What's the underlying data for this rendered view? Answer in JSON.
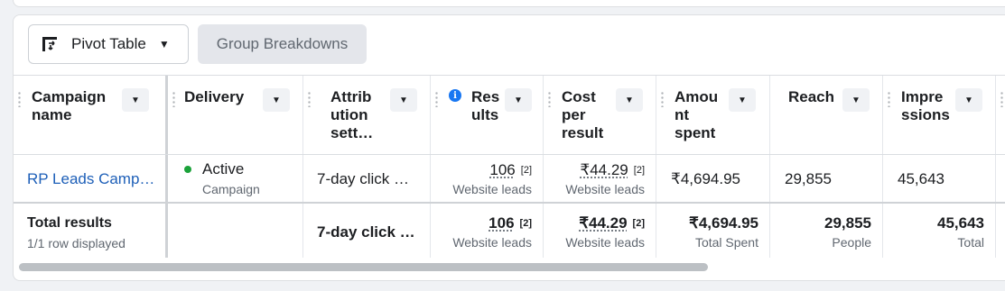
{
  "toolbar": {
    "pivot_label": "Pivot Table",
    "group_label": "Group Breakdowns"
  },
  "columns": [
    {
      "title_lines": [
        "Campaign",
        "name"
      ]
    },
    {
      "title_lines": [
        "Delivery"
      ]
    },
    {
      "title_lines": [
        "Attrib",
        "ution",
        "sett…"
      ]
    },
    {
      "title_lines": [
        "Res",
        "ults"
      ],
      "info": "i"
    },
    {
      "title_lines": [
        "Cost",
        "per",
        "result"
      ]
    },
    {
      "title_lines": [
        "Amou",
        "nt",
        "spent"
      ]
    },
    {
      "title_lines": [
        "Reach"
      ]
    },
    {
      "title_lines": [
        "Impre",
        "ssions"
      ]
    }
  ],
  "row": {
    "campaign_name": "RP Leads Camp…",
    "delivery_status": "Active",
    "delivery_sub": "Campaign",
    "attribution": "7-day click …",
    "results": "106",
    "results_fn": "[2]",
    "results_sub": "Website leads",
    "cost_per_result": "₹44.29",
    "cost_fn": "[2]",
    "cost_sub": "Website leads",
    "amount_spent": "₹4,694.95",
    "reach": "29,855",
    "impressions": "45,643"
  },
  "totals": {
    "label": "Total results",
    "sub": "1/1 row displayed",
    "attribution": "7-day click …",
    "results": "106",
    "results_fn": "[2]",
    "results_sub": "Website leads",
    "cost_per_result": "₹44.29",
    "cost_fn": "[2]",
    "cost_sub": "Website leads",
    "amount_spent": "₹4,694.95",
    "amount_sub": "Total Spent",
    "reach": "29,855",
    "reach_sub": "People",
    "impressions": "45,643",
    "impressions_sub": "Total"
  },
  "icons": {
    "pivot": "pivot-table-icon",
    "caret": "caret-down-icon",
    "sort": "sort-caret-icon",
    "info": "info-icon"
  },
  "colors": {
    "link": "#1d5fb8",
    "active_dot": "#1ba23a",
    "info": "#1877f2"
  }
}
